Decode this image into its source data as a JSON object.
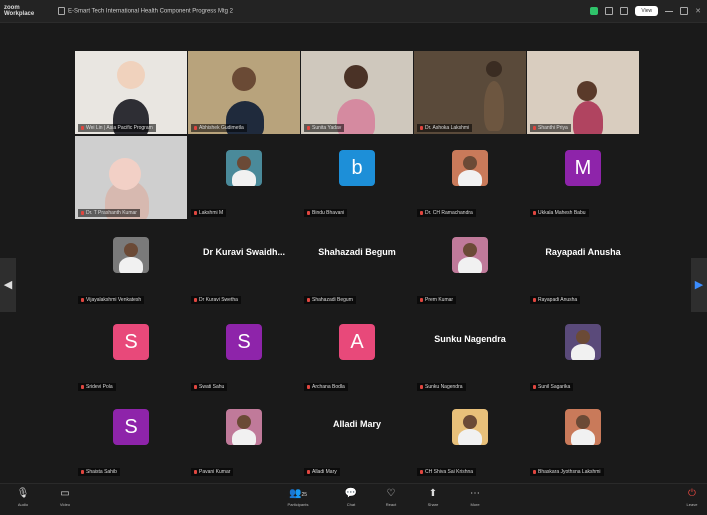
{
  "app": {
    "logo_line1": "zoom",
    "logo_line2": "Workplace"
  },
  "titlebar": {
    "meeting_title": "E-Smart Tech International Health Component Progress Mtg 2",
    "view_label": "View"
  },
  "nav": {
    "prev_arrow": "◀",
    "next_arrow": "▶"
  },
  "tiles": [
    {
      "type": "video",
      "label": "Wei Lin | Asia Pacific Program",
      "name": "",
      "initial": "",
      "color": ""
    },
    {
      "type": "video",
      "label": "Abhishek Gudimetla",
      "name": "",
      "initial": "",
      "color": ""
    },
    {
      "type": "video",
      "label": "Sunita Yadav",
      "name": "",
      "initial": "",
      "color": ""
    },
    {
      "type": "video",
      "label": "Dr. Ashoka Lakshmi",
      "name": "",
      "initial": "",
      "color": ""
    },
    {
      "type": "video",
      "label": "Shanthi Priya",
      "name": "",
      "initial": "",
      "color": ""
    },
    {
      "type": "video",
      "label": "Dr. T Prashanth Kumar",
      "name": "",
      "initial": "",
      "color": ""
    },
    {
      "type": "photo",
      "label": "Lakshmi M",
      "name": "",
      "initial": "",
      "color": ""
    },
    {
      "type": "initial",
      "label": "Bindu Bhavani",
      "name": "",
      "initial": "b",
      "color": "#1d8fd8"
    },
    {
      "type": "photo",
      "label": "Dr. CH Ramachandra",
      "name": "",
      "initial": "",
      "color": ""
    },
    {
      "type": "initial",
      "label": "Ukkala Mahesh Babu",
      "name": "",
      "initial": "M",
      "color": "#8e24aa"
    },
    {
      "type": "photo",
      "label": "Vijayalakshmi Venkatesh",
      "name": "",
      "initial": "",
      "color": ""
    },
    {
      "type": "name",
      "label": "Dr Kuravi Swetha",
      "name": "Dr Kuravi Swaidh...",
      "initial": "",
      "color": ""
    },
    {
      "type": "name",
      "label": "Shahazadi Begum",
      "name": "Shahazadi Begum",
      "initial": "",
      "color": ""
    },
    {
      "type": "photo",
      "label": "Prem Kumar",
      "name": "",
      "initial": "",
      "color": ""
    },
    {
      "type": "name",
      "label": "Rayapadi Anusha",
      "name": "Rayapadi Anusha",
      "initial": "",
      "color": ""
    },
    {
      "type": "initial",
      "label": "Sridevi Pola",
      "name": "",
      "initial": "S",
      "color": "#e8497a"
    },
    {
      "type": "initial",
      "label": "Swati Sahu",
      "name": "",
      "initial": "S",
      "color": "#8e24aa"
    },
    {
      "type": "initial",
      "label": "Archana Bodla",
      "name": "",
      "initial": "A",
      "color": "#e8497a"
    },
    {
      "type": "name",
      "label": "Sunku Nagendra",
      "name": "Sunku Nagendra",
      "initial": "",
      "color": ""
    },
    {
      "type": "photo",
      "label": "Sunil Sagarika",
      "name": "",
      "initial": "",
      "color": ""
    },
    {
      "type": "initial",
      "label": "Shaista Sahib",
      "name": "",
      "initial": "S",
      "color": "#8e24aa"
    },
    {
      "type": "photo",
      "label": "Pavani Kumar",
      "name": "",
      "initial": "",
      "color": ""
    },
    {
      "type": "name",
      "label": "Alladi Mary",
      "name": "Alladi Mary",
      "initial": "",
      "color": ""
    },
    {
      "type": "photo",
      "label": "CH Shiva Sai Krishna",
      "name": "",
      "initial": "",
      "color": ""
    },
    {
      "type": "photo",
      "label": "Bhaskara Jyothsna Lakshmi",
      "name": "",
      "initial": "",
      "color": ""
    }
  ],
  "toolbar": {
    "audio": {
      "label": "Audio",
      "icon": "🎙"
    },
    "video": {
      "label": "Video",
      "icon": "▭"
    },
    "participants": {
      "label": "Participants",
      "icon": "👥",
      "count": "25"
    },
    "chat": {
      "label": "Chat",
      "icon": "💬"
    },
    "react": {
      "label": "React",
      "icon": "♡"
    },
    "share": {
      "label": "Share",
      "icon": "⬆"
    },
    "more": {
      "label": "More",
      "icon": "⋯"
    },
    "leave": {
      "label": "Leave",
      "icon": "⏻"
    }
  },
  "colors": {
    "speaker_border": "#41c46e",
    "leave": "#e0463f",
    "bg": "#1a1a1a"
  }
}
